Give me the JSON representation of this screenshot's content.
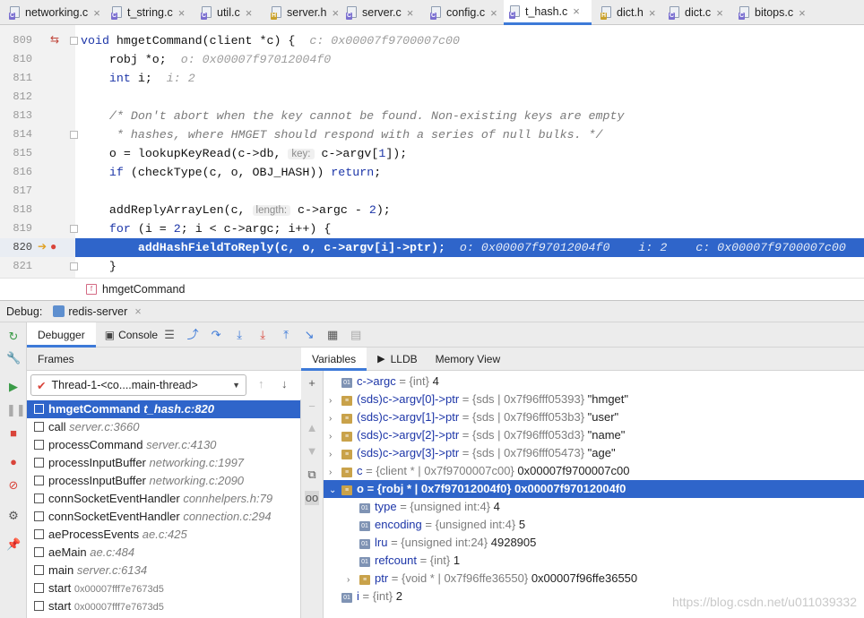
{
  "tabs": [
    {
      "label": "networking.c",
      "kind": "c"
    },
    {
      "label": "t_string.c",
      "kind": "c"
    },
    {
      "label": "util.c",
      "kind": "c"
    },
    {
      "label": "server.h",
      "kind": "h"
    },
    {
      "label": "server.c",
      "kind": "c"
    },
    {
      "label": "config.c",
      "kind": "c"
    },
    {
      "label": "t_hash.c",
      "kind": "c",
      "active": true
    },
    {
      "label": "dict.h",
      "kind": "h"
    },
    {
      "label": "dict.c",
      "kind": "c"
    },
    {
      "label": "bitops.c",
      "kind": "c"
    }
  ],
  "editor": {
    "lines": [
      "809",
      "810",
      "811",
      "812",
      "813",
      "814",
      "815",
      "816",
      "817",
      "818",
      "819",
      "820",
      "821"
    ],
    "l809": {
      "a": "void ",
      "b": "hmgetCommand(client *c) {  ",
      "i": "c: 0x00007f9700007c00"
    },
    "l810": {
      "a": "    robj *o;  ",
      "i": "o: 0x00007f97012004f0"
    },
    "l811": {
      "k": "int",
      "a": " i;  ",
      "i": "i: 2"
    },
    "l813": "    /* Don't abort when the key cannot be found. Non-existing keys are empty",
    "l814": "     * hashes, where HMGET should respond with a series of null bulks. */",
    "l815": {
      "a": "    o = lookupKeyRead(c->db, ",
      "hint": "key:",
      "b": " c->argv[",
      "n": "1",
      "c": "]);"
    },
    "l816": {
      "k": "if",
      "a": " (checkType(c, o, OBJ_HASH)) ",
      "r": "return",
      "b": ";"
    },
    "l818": {
      "a": "    addReplyArrayLen(c, ",
      "hint": "length:",
      "b": " c->argc - ",
      "n": "2",
      "c": ");"
    },
    "l819": {
      "k": "for",
      "a": " (i = ",
      "n": "2",
      "b": "; i < c->argc; i++) {"
    },
    "l820": {
      "a": "        addHashFieldToReply(c, o, c->argv[i]->ptr);  ",
      "i": "o: 0x00007f97012004f0    i: 2    c: 0x00007f9700007c00"
    },
    "l821": "    }"
  },
  "breadcrumb": "hmgetCommand",
  "debug": {
    "label": "Debug:",
    "session": "redis-server",
    "debugger_tab": "Debugger",
    "console_tab": "Console",
    "frames_label": "Frames",
    "variables_tab": "Variables",
    "lldb_tab": "LLDB",
    "memory_tab": "Memory View",
    "thread": "Thread-1-<co....main-thread>"
  },
  "frames": [
    {
      "fn": "hmgetCommand",
      "loc": "t_hash.c:820",
      "sel": true
    },
    {
      "fn": "call",
      "loc": "server.c:3660"
    },
    {
      "fn": "processCommand",
      "loc": "server.c:4130"
    },
    {
      "fn": "processInputBuffer",
      "loc": "networking.c:1997"
    },
    {
      "fn": "processInputBuffer",
      "loc": "networking.c:2090"
    },
    {
      "fn": "connSocketEventHandler",
      "loc": "connhelpers.h:79"
    },
    {
      "fn": "connSocketEventHandler",
      "loc": "connection.c:294"
    },
    {
      "fn": "aeProcessEvents",
      "loc": "ae.c:425"
    },
    {
      "fn": "aeMain",
      "loc": "ae.c:484"
    },
    {
      "fn": "main",
      "loc": "server.c:6134"
    },
    {
      "fn": "start",
      "addr": "0x00007fff7e7673d5"
    },
    {
      "fn": "start",
      "addr": "0x00007fff7e7673d5"
    }
  ],
  "variables": [
    {
      "name": "c->argc",
      "type": " = {int} ",
      "val": "4",
      "icon": "01",
      "indent": 0,
      "arrow": ""
    },
    {
      "name": "(sds)c->argv[0]->ptr",
      "type": " = {sds | 0x7f96fff05393} ",
      "val": "\"hmget\"",
      "icon": "s",
      "indent": 0,
      "arrow": "›"
    },
    {
      "name": "(sds)c->argv[1]->ptr",
      "type": " = {sds | 0x7f96fff053b3} ",
      "val": "\"user\"",
      "icon": "s",
      "indent": 0,
      "arrow": "›"
    },
    {
      "name": "(sds)c->argv[2]->ptr",
      "type": " = {sds | 0x7f96fff053d3} ",
      "val": "\"name\"",
      "icon": "s",
      "indent": 0,
      "arrow": "›"
    },
    {
      "name": "(sds)c->argv[3]->ptr",
      "type": " = {sds | 0x7f96fff05473} ",
      "val": "\"age\"",
      "icon": "s",
      "indent": 0,
      "arrow": "›"
    },
    {
      "name": "c",
      "type": " = {client * | 0x7f9700007c00} ",
      "val": "0x00007f9700007c00",
      "icon": "s",
      "indent": 0,
      "arrow": "›"
    },
    {
      "name": "o",
      "type": " = {robj * | 0x7f97012004f0} ",
      "val": "0x00007f97012004f0",
      "icon": "s",
      "indent": 0,
      "arrow": "⌄",
      "sel": true
    },
    {
      "name": "type",
      "type": " = {unsigned int:4} ",
      "val": "4",
      "icon": "01",
      "indent": 1,
      "arrow": ""
    },
    {
      "name": "encoding",
      "type": " = {unsigned int:4} ",
      "val": "5",
      "icon": "01",
      "indent": 1,
      "arrow": ""
    },
    {
      "name": "lru",
      "type": " = {unsigned int:24} ",
      "val": "4928905",
      "icon": "01",
      "indent": 1,
      "arrow": ""
    },
    {
      "name": "refcount",
      "type": " = {int} ",
      "val": "1",
      "icon": "01",
      "indent": 1,
      "arrow": ""
    },
    {
      "name": "ptr",
      "type": " = {void * | 0x7f96ffe36550} ",
      "val": "0x00007f96ffe36550",
      "icon": "s",
      "indent": 1,
      "arrow": "›"
    },
    {
      "name": "i",
      "type": " = {int} ",
      "val": "2",
      "icon": "01",
      "indent": 0,
      "arrow": ""
    }
  ],
  "watermark": "https://blog.csdn.net/u011039332"
}
